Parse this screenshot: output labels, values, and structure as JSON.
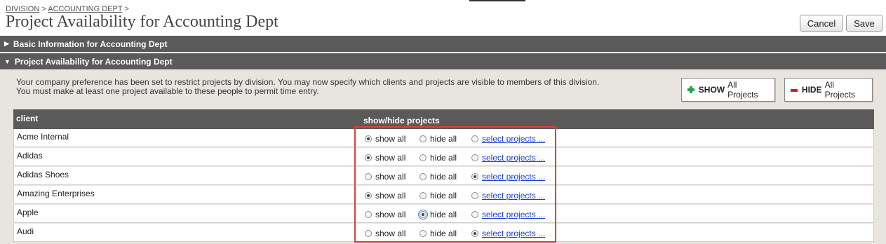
{
  "breadcrumb": {
    "division": "DIVISION",
    "sep1": " > ",
    "dept": "ACCOUNTING DEPT",
    "sep2": " >"
  },
  "page_title": "Project Availability for Accounting Dept",
  "header_buttons": {
    "cancel": "Cancel",
    "save": "Save"
  },
  "sections": {
    "basic": {
      "label": "Basic Information for Accounting Dept",
      "expanded": false
    },
    "availability": {
      "label": "Project Availability for Accounting Dept",
      "expanded": true
    }
  },
  "intro": {
    "line1": "Your company preference has been set to restrict projects by division. You may now specify which clients and projects are visible to members of this division.",
    "line2": "You must make at least one project available to these people to permit time entry."
  },
  "bulk_buttons": {
    "show_bold": "SHOW",
    "show_rest": "All Projects",
    "hide_bold": "HIDE",
    "hide_rest": "All Projects"
  },
  "table": {
    "col_client": "client",
    "col_showhide": "show/hide projects",
    "option_labels": {
      "show": "show all",
      "hide": "hide all",
      "select": "select projects ..."
    },
    "rows": [
      {
        "client": "Acme Internal",
        "selected": "show"
      },
      {
        "client": "Adidas",
        "selected": "show"
      },
      {
        "client": "Adidas Shoes",
        "selected": "select"
      },
      {
        "client": "Amazing Enterprises",
        "selected": "show"
      },
      {
        "client": "Apple",
        "selected": "hide"
      },
      {
        "client": "Audi",
        "selected": "select"
      }
    ]
  },
  "colors": {
    "section_bar": "#5a5a5a",
    "panel_bg": "#e8e5e1",
    "link": "#1a3fd1",
    "highlight": "#d94040"
  }
}
